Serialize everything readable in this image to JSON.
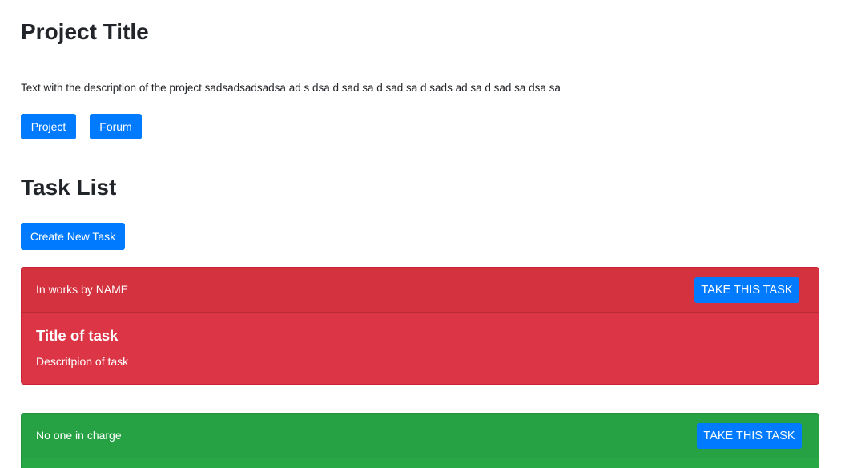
{
  "project": {
    "title": "Project Title",
    "description": "Text with the description of the project sadsadsadsadsa ad s dsa d sad sa d sad sa d sads ad sa d sad sa dsa sa",
    "buttons": {
      "project_label": "Project",
      "forum_label": "Forum"
    }
  },
  "task_list": {
    "title": "Task List",
    "create_label": "Create New Task",
    "tasks": [
      {
        "status": "In works by NAME",
        "take_label": "TAKE THIS TASK",
        "title": "Title of task",
        "description": "Descritpion of task",
        "color": "#dc3545"
      },
      {
        "status": "No one in charge",
        "take_label": "TAKE THIS TASK",
        "color": "#28a745"
      }
    ]
  },
  "colors": {
    "primary": "#007bff",
    "danger": "#dc3545",
    "success": "#28a745",
    "text": "#212529"
  }
}
